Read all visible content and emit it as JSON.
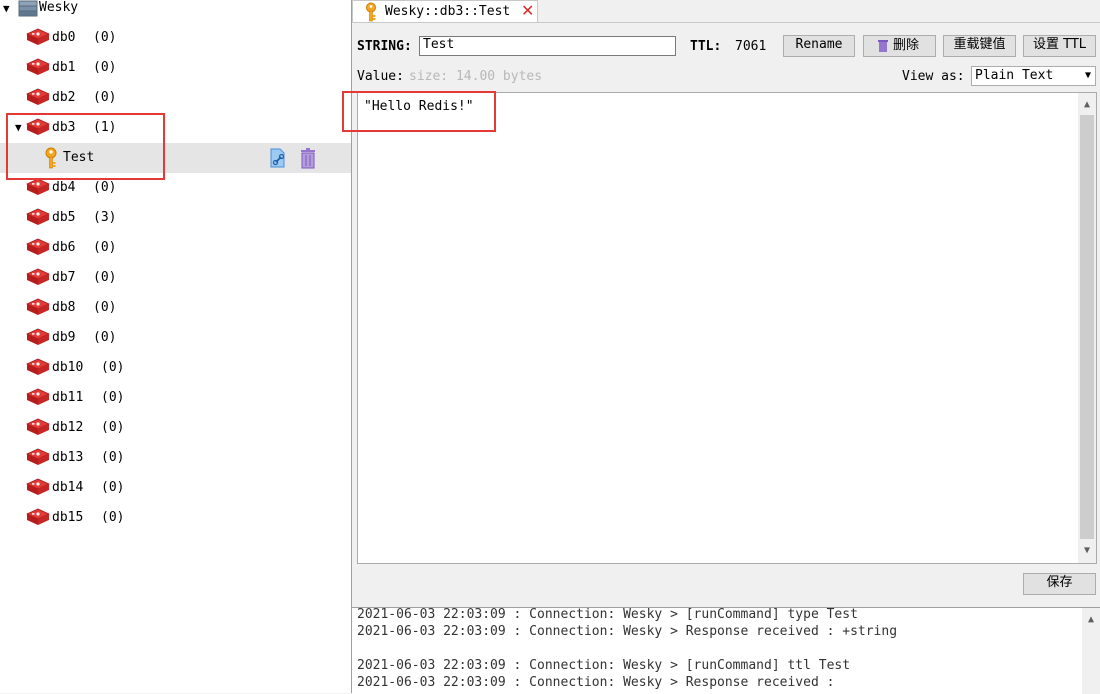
{
  "tree": {
    "connection": "Wesky",
    "dbs": [
      {
        "name": "db0",
        "count": "(0)"
      },
      {
        "name": "db1",
        "count": "(0)"
      },
      {
        "name": "db2",
        "count": "(0)"
      },
      {
        "name": "db3",
        "count": "(1)",
        "expanded": true
      },
      {
        "name": "db4",
        "count": "(0)"
      },
      {
        "name": "db5",
        "count": "(3)"
      },
      {
        "name": "db6",
        "count": "(0)"
      },
      {
        "name": "db7",
        "count": "(0)"
      },
      {
        "name": "db8",
        "count": "(0)"
      },
      {
        "name": "db9",
        "count": "(0)"
      },
      {
        "name": "db10",
        "count": "(0)"
      },
      {
        "name": "db11",
        "count": "(0)"
      },
      {
        "name": "db12",
        "count": "(0)"
      },
      {
        "name": "db13",
        "count": "(0)"
      },
      {
        "name": "db14",
        "count": "(0)"
      },
      {
        "name": "db15",
        "count": "(0)"
      }
    ],
    "key_item": "Test",
    "icons": [
      "server-icon",
      "redis-db-icon",
      "key-icon",
      "copy-link-icon",
      "trash-icon"
    ]
  },
  "tab": {
    "title": "Wesky::db3::Test"
  },
  "key_header": {
    "type_label": "STRING:",
    "key_name": "Test",
    "ttl_label": "TTL:",
    "ttl_value": "7061",
    "rename": "Rename",
    "delete": "删除",
    "reload": "重载键值",
    "set_ttl": "设置 TTL"
  },
  "value": {
    "label": "Value:",
    "size": "size: 14.00 bytes",
    "view_as_label": "View as:",
    "view_as_selected": "Plain Text",
    "content": "\"Hello Redis!\""
  },
  "save_button": "保存",
  "log": [
    "2021-06-03 22:03:09 : Connection: Wesky > [runCommand] type Test",
    "2021-06-03 22:03:09 : Connection: Wesky > Response received : +string",
    "",
    "2021-06-03 22:03:09 : Connection: Wesky > [runCommand] ttl Test",
    "2021-06-03 22:03:09 : Connection: Wesky > Response received :"
  ],
  "colors": {
    "highlight_box": "#e53935",
    "db_icon": "#d32f2f",
    "key_icon": "#f5a623",
    "trash_icon": "#7e57c2",
    "link_icon": "#64b5f6"
  }
}
